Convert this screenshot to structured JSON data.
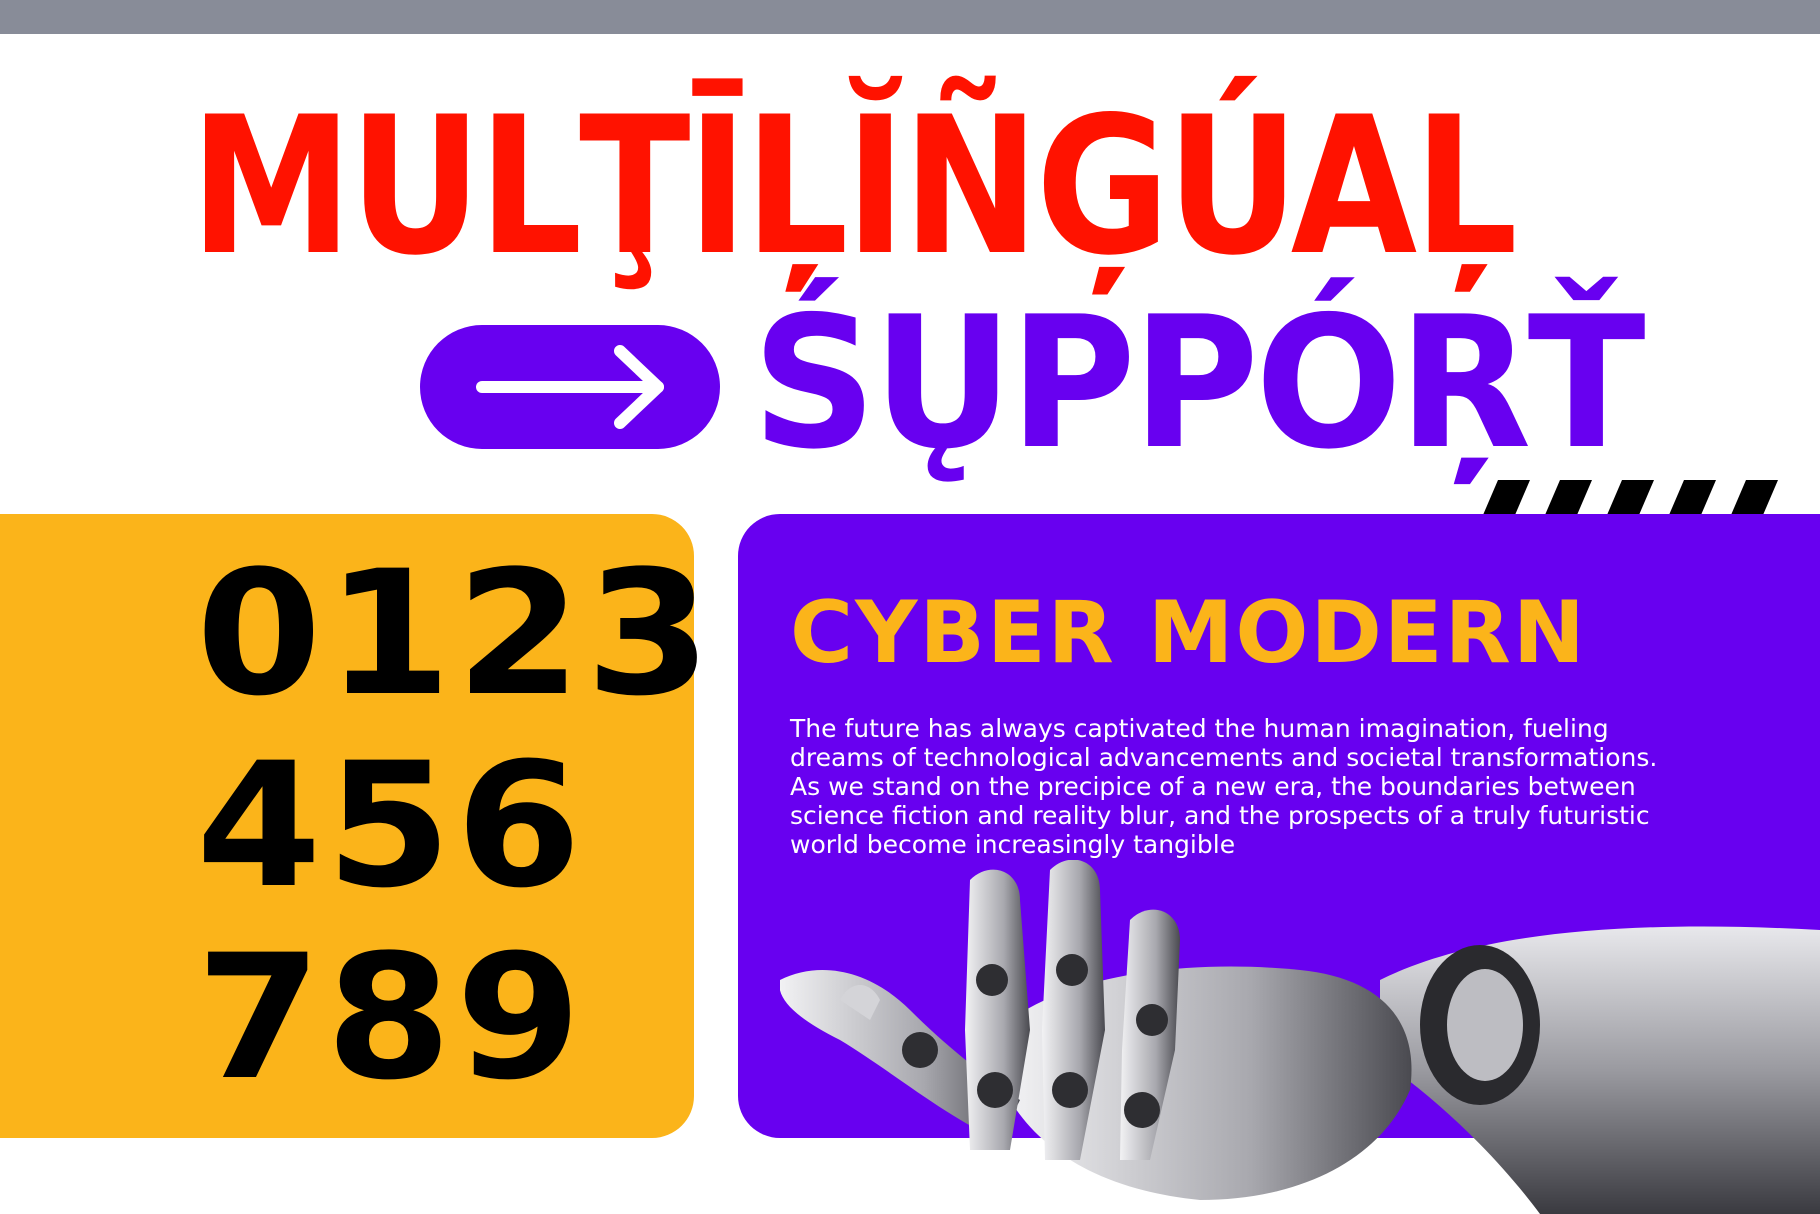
{
  "headline": {
    "line1": "MULŢĪĻĬÑĢÚAĻ",
    "line2": "ŚŲPPÓŖŤ",
    "line1_color": "#ff1200",
    "line2_color": "#6800f0"
  },
  "arrow_pill": {
    "icon": "right-arrow-icon",
    "color": "#6800f0"
  },
  "digits_panel": {
    "background": "#fbb41a",
    "rows": [
      "0123",
      "456",
      "789"
    ],
    "digit_color": "#000000"
  },
  "info_panel": {
    "background": "#6800f0",
    "title": "CYBER MODERN",
    "title_color": "#fbb41a",
    "body": "The future has always captivated the human imagination, fueling dreams of technological advancements and societal transformations. As we stand on the precipice of a new era, the boundaries between science fiction and reality blur, and the prospects of a truly futuristic world become increasingly tangible"
  },
  "decor": {
    "top_bar_color": "#888c98",
    "stripes_color": "#000000",
    "image": "robot-hand-image"
  }
}
